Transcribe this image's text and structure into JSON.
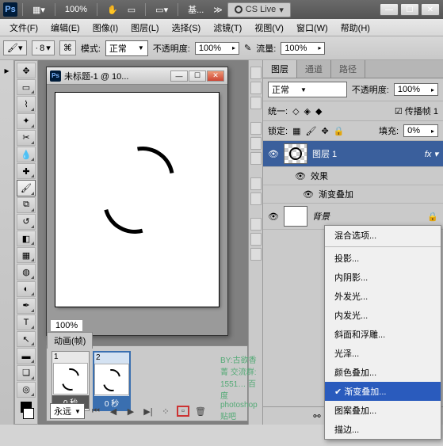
{
  "titlebar": {
    "zoom": "100%",
    "workspace_label": "基...",
    "cslive": "CS Live"
  },
  "menu": {
    "file": "文件(F)",
    "edit": "编辑(E)",
    "image": "图像(I)",
    "layer": "图层(L)",
    "select": "选择(S)",
    "filter": "滤镜(T)",
    "view": "视图(V)",
    "window": "窗口(W)",
    "help": "帮助(H)"
  },
  "options": {
    "size_label": "·",
    "size_value": "8",
    "mode_label": "模式:",
    "mode_value": "正常",
    "opacity_label": "不透明度:",
    "opacity_value": "100%",
    "flow_label": "流量:",
    "flow_value": "100%"
  },
  "doc": {
    "title": "未标题-1 @ 10...",
    "zoom": "100%"
  },
  "layers_panel": {
    "tabs": {
      "layers": "图层",
      "channels": "通道",
      "paths": "路径"
    },
    "blend_mode": "正常",
    "opacity_label": "不透明度:",
    "opacity_value": "100%",
    "unify_label": "统一:",
    "propagate": "传播帧 1",
    "lock_label": "锁定:",
    "fill_label": "填充:",
    "fill_value": "0%",
    "layer1": "图层 1",
    "effects": "效果",
    "gradient_overlay": "渐变叠加",
    "background": "背景"
  },
  "anim": {
    "tab": "动画(帧)",
    "frame1_dur": "0 秒",
    "frame2_dur": "0 秒",
    "loop": "永远"
  },
  "fx_menu": {
    "blending": "混合选项...",
    "drop_shadow": "投影...",
    "inner_shadow": "内阴影...",
    "outer_glow": "外发光...",
    "inner_glow": "内发光...",
    "bevel": "斜面和浮雕...",
    "satin": "光泽...",
    "color_overlay": "颜色叠加...",
    "gradient_overlay": "渐变叠加...",
    "pattern_overlay": "图案叠加...",
    "stroke": "描边..."
  },
  "watermark": "BY:古欲香菁    交流群: 1551…     百度photoshop贴吧"
}
